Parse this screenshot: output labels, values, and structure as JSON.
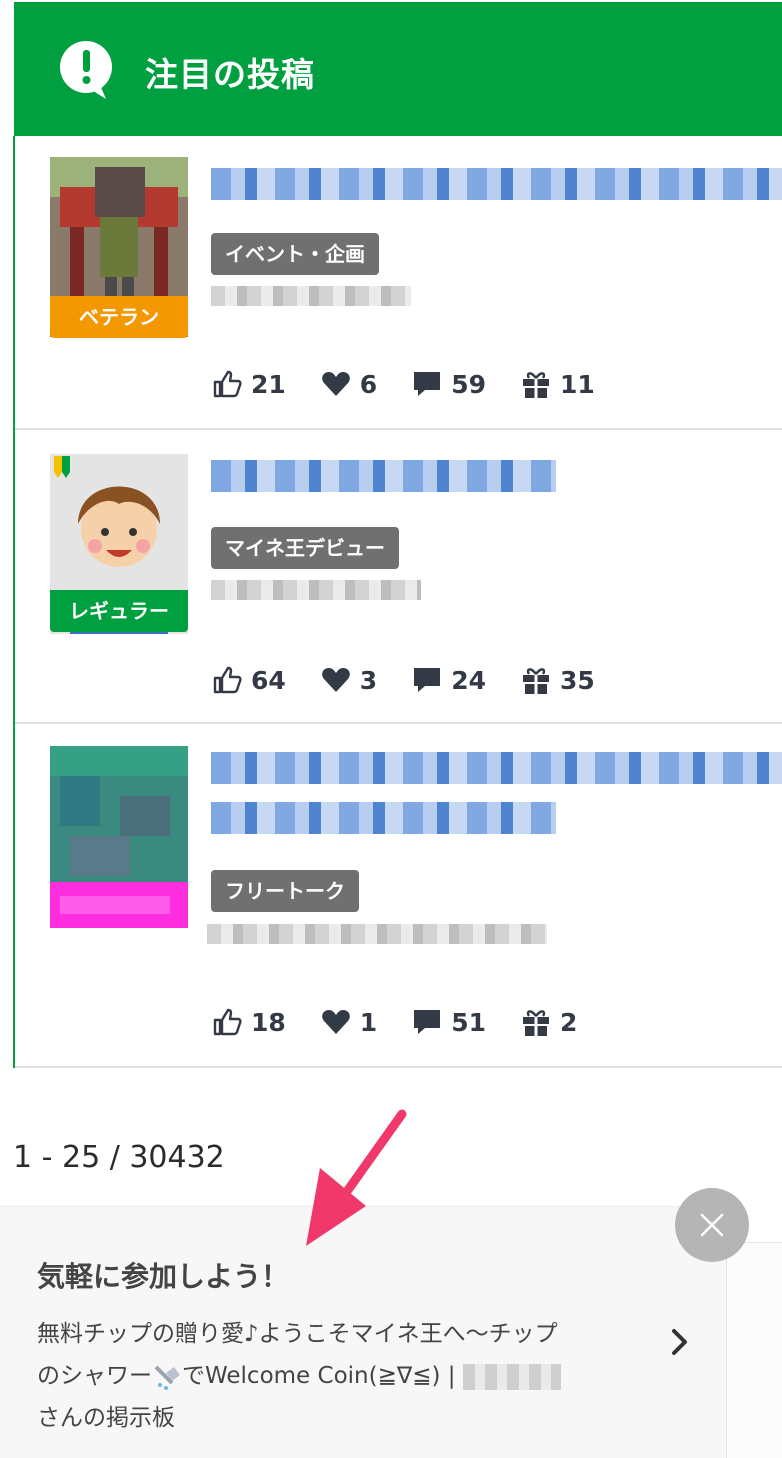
{
  "header": {
    "title": "注目の投稿",
    "icon": "exclamation-bubble-icon"
  },
  "posts": [
    {
      "rank": "ベテラン",
      "rank_color": "#f39800",
      "category": "イベント・企画",
      "likes": "21",
      "hearts": "6",
      "comments": "59",
      "gifts": "11"
    },
    {
      "rank": "レギュラー",
      "rank_color": "#00a040",
      "category": "マイネ王デビュー",
      "likes": "64",
      "hearts": "3",
      "comments": "24",
      "gifts": "35"
    },
    {
      "rank": "",
      "rank_color": "#ff2de0",
      "category": "フリートーク",
      "likes": "18",
      "hearts": "1",
      "comments": "51",
      "gifts": "2"
    }
  ],
  "pagination": {
    "text": "1 - 25 / 30432"
  },
  "promo": {
    "title": "気軽に参加しよう！",
    "body_line1": "無料チップの贈り愛♪ようこそマイネ王へ〜チップ",
    "body_line2_a": "のシャワー",
    "body_line2_b": "でWelcome Coin(≧∇≦) |",
    "body_line3": "さんの掲示板"
  },
  "colors": {
    "brand_green": "#00a040",
    "arrow": "#f0386b"
  }
}
